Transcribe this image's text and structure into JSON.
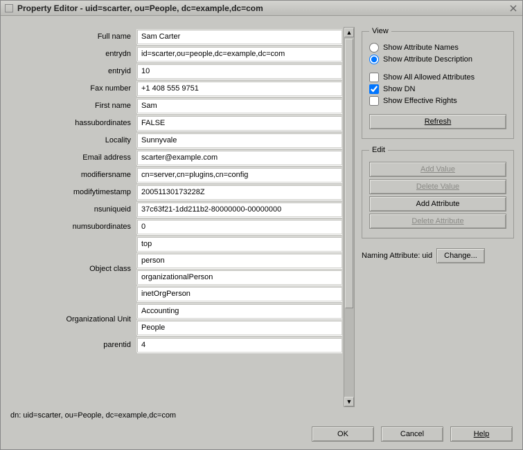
{
  "window": {
    "title": "Property Editor - uid=scarter, ou=People, dc=example,dc=com"
  },
  "fields": {
    "fullName": {
      "label": "Full name",
      "value": "Sam Carter"
    },
    "entrydn": {
      "label": "entrydn",
      "value": "id=scarter,ou=people,dc=example,dc=com"
    },
    "entryid": {
      "label": "entryid",
      "value": "10"
    },
    "fax": {
      "label": "Fax number",
      "value": "+1 408 555 9751"
    },
    "firstName": {
      "label": "First name",
      "value": "Sam"
    },
    "hasSubordinates": {
      "label": "hassubordinates",
      "value": "FALSE"
    },
    "locality": {
      "label": "Locality",
      "value": "Sunnyvale"
    },
    "email": {
      "label": "Email address",
      "value": "scarter@example.com"
    },
    "modifiersName": {
      "label": "modifiersname",
      "value": "cn=server,cn=plugins,cn=config"
    },
    "modifyTimestamp": {
      "label": "modifytimestamp",
      "value": "20051130173228Z"
    },
    "nsUniqueId": {
      "label": "nsuniqueid",
      "value": "37c63f21-1dd211b2-80000000-00000000"
    },
    "numSubordinates": {
      "label": "numsubordinates",
      "value": "0"
    },
    "objectClass": {
      "label": "Object class",
      "values": [
        "top",
        "person",
        "organizationalPerson",
        "inetOrgPerson"
      ]
    },
    "orgUnit": {
      "label": "Organizational Unit",
      "values": [
        "Accounting",
        "People"
      ]
    },
    "parentId": {
      "label": "parentid",
      "value": "4"
    }
  },
  "view": {
    "legend": "View",
    "radio": {
      "names": {
        "label": "Show Attribute Names",
        "checked": false
      },
      "description": {
        "label": "Show Attribute Description",
        "checked": true
      }
    },
    "checks": {
      "allAllowed": {
        "label": "Show All Allowed Attributes",
        "checked": false
      },
      "showDN": {
        "label": "Show DN",
        "checked": true
      },
      "effective": {
        "label": "Show Effective Rights",
        "checked": false
      }
    },
    "refresh": "Refresh"
  },
  "edit": {
    "legend": "Edit",
    "addValue": "Add Value",
    "deleteValue": "Delete Value",
    "addAttr": "Add Attribute",
    "deleteAttr": "Delete Attribute"
  },
  "naming": {
    "label": "Naming Attribute: uid",
    "button": "Change..."
  },
  "dnLine": "dn: uid=scarter, ou=People, dc=example,dc=com",
  "footer": {
    "ok": "OK",
    "cancel": "Cancel",
    "help": "Help"
  }
}
